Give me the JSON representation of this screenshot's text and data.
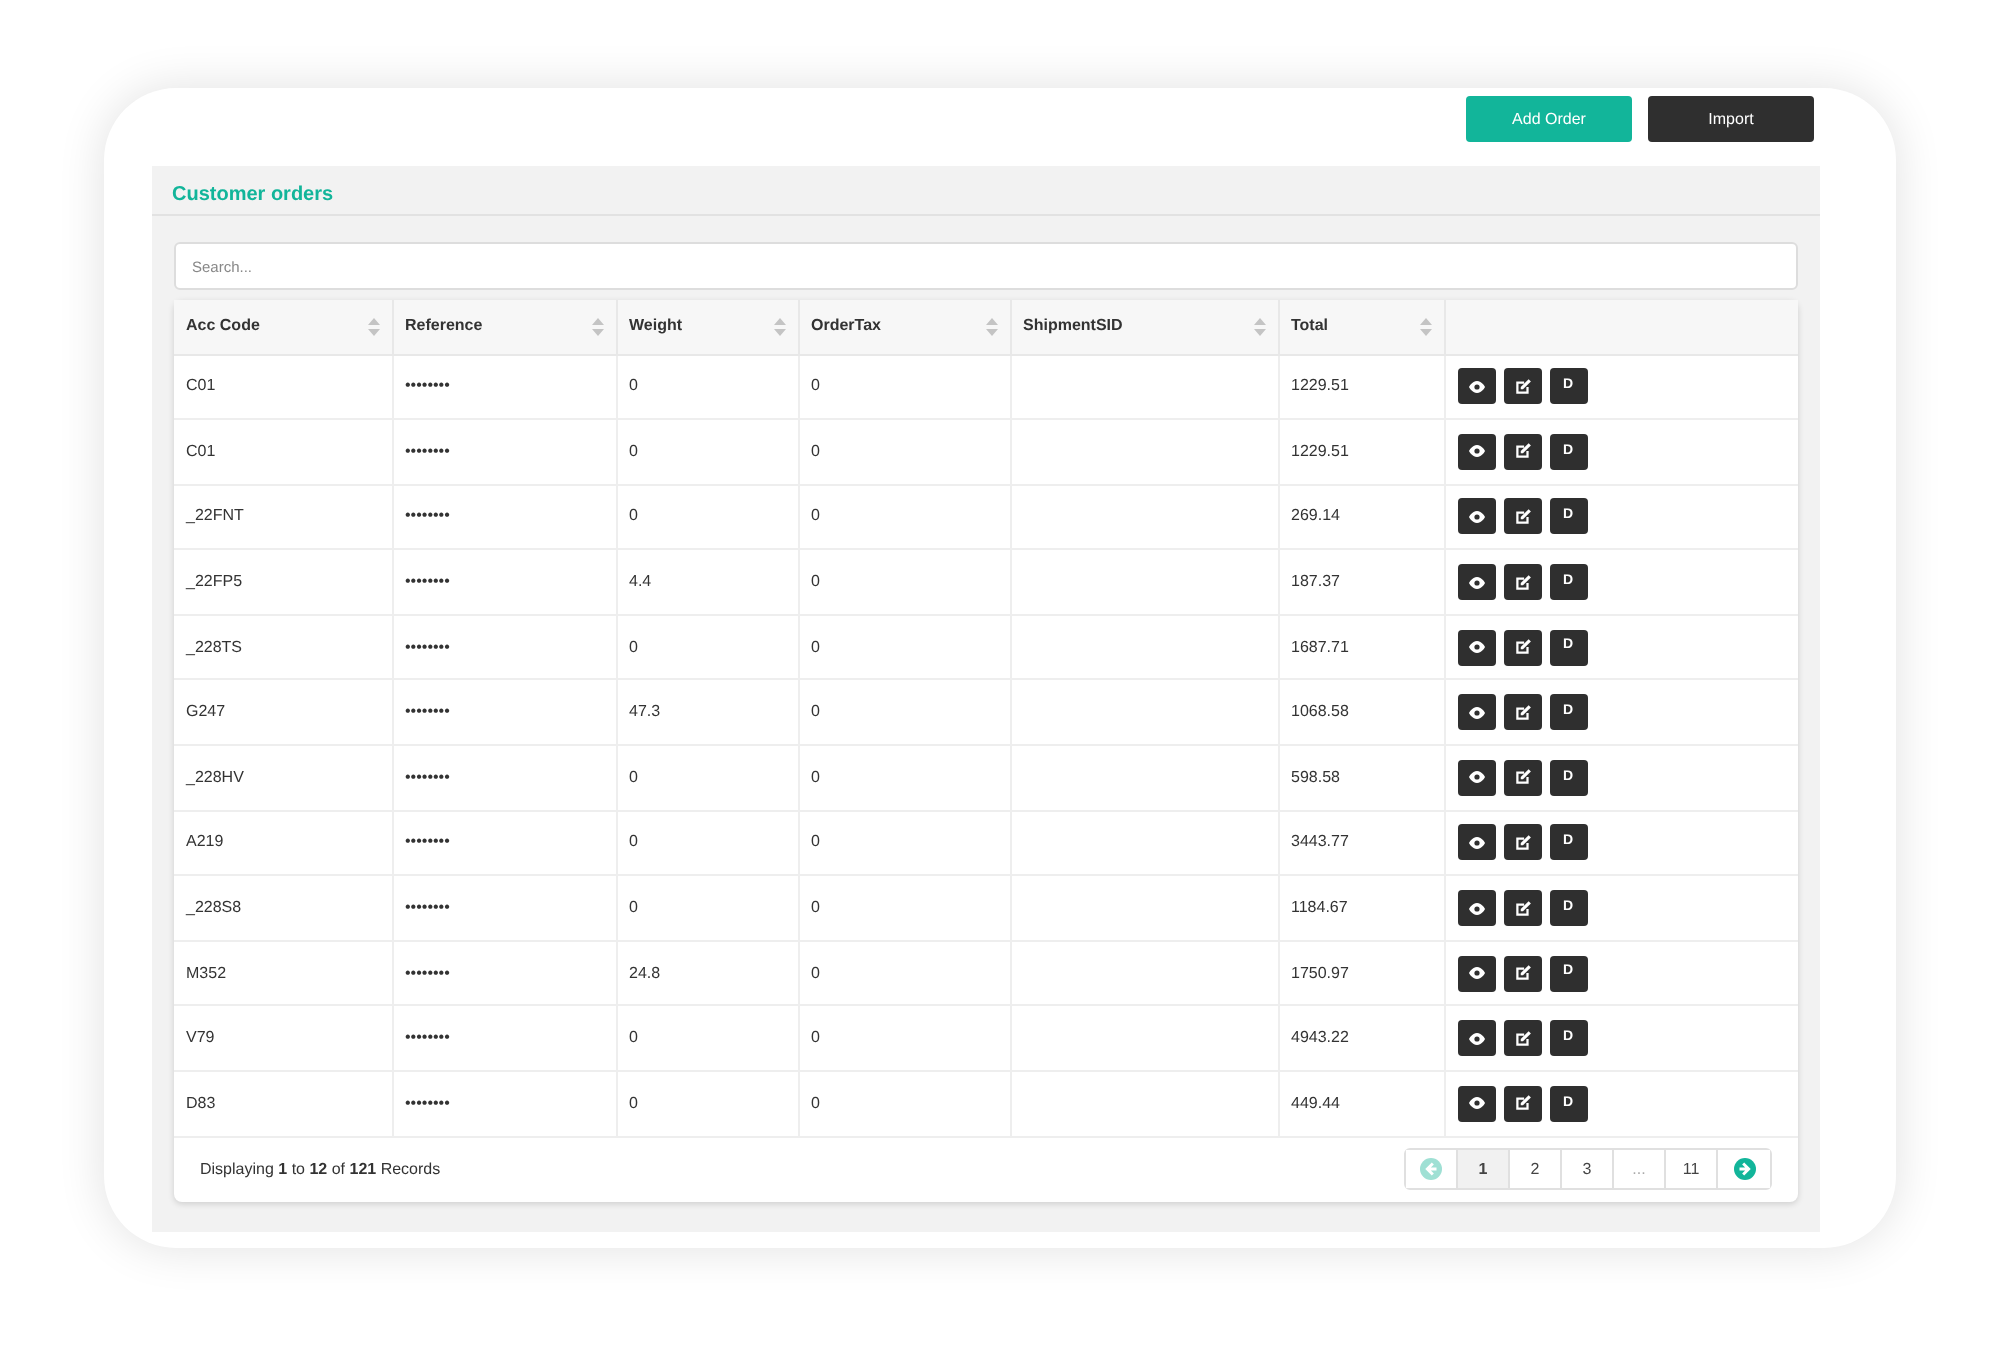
{
  "header_buttons": [
    {
      "label": "Add Order",
      "kind": "primary"
    },
    {
      "label": "Import",
      "kind": "dark"
    }
  ],
  "panel": {
    "title": "Customer orders"
  },
  "search": {
    "placeholder": "Search..."
  },
  "table": {
    "columns": [
      {
        "label": "Acc Code",
        "sortable": true
      },
      {
        "label": "Reference",
        "sortable": true
      },
      {
        "label": "Weight",
        "sortable": true
      },
      {
        "label": "OrderTax",
        "sortable": true
      },
      {
        "label": "ShipmentSID",
        "sortable": true
      },
      {
        "label": "Total",
        "sortable": true
      },
      {
        "sortable": false
      }
    ],
    "rows": [
      {
        "acc_code": "C01",
        "reference": "••••••••",
        "weight": "0",
        "order_tax": "0",
        "total": "1229.51",
        "delete_label": "D"
      },
      {
        "acc_code": "C01",
        "reference": "••••••••",
        "weight": "0",
        "order_tax": "0",
        "total": "1229.51",
        "delete_label": "D"
      },
      {
        "acc_code": "_22FNT",
        "reference": "••••••••",
        "weight": "0",
        "order_tax": "0",
        "total": "269.14",
        "delete_label": "D"
      },
      {
        "acc_code": "_22FP5",
        "reference": "••••••••",
        "weight": "4.4",
        "order_tax": "0",
        "total": "187.37",
        "delete_label": "D"
      },
      {
        "acc_code": "_228TS",
        "reference": "••••••••",
        "weight": "0",
        "order_tax": "0",
        "total": "1687.71",
        "delete_label": "D"
      },
      {
        "acc_code": "G247",
        "reference": "••••••••",
        "weight": "47.3",
        "order_tax": "0",
        "total": "1068.58",
        "delete_label": "D"
      },
      {
        "acc_code": "_228HV",
        "reference": "••••••••",
        "weight": "0",
        "order_tax": "0",
        "total": "598.58",
        "delete_label": "D"
      },
      {
        "acc_code": "A219",
        "reference": "••••••••",
        "weight": "0",
        "order_tax": "0",
        "total": "3443.77",
        "delete_label": "D"
      },
      {
        "acc_code": "_228S8",
        "reference": "••••••••",
        "weight": "0",
        "order_tax": "0",
        "total": "1184.67",
        "delete_label": "D"
      },
      {
        "acc_code": "M352",
        "reference": "••••••••",
        "weight": "24.8",
        "order_tax": "0",
        "total": "1750.97",
        "delete_label": "D"
      },
      {
        "acc_code": "V79",
        "reference": "••••••••",
        "weight": "0",
        "order_tax": "0",
        "total": "4943.22",
        "delete_label": "D"
      },
      {
        "acc_code": "D83",
        "reference": "••••••••",
        "weight": "0",
        "order_tax": "0",
        "total": "449.44",
        "delete_label": "D"
      }
    ]
  },
  "footer": {
    "summary": "Displaying **1** to **12** of **121** Records",
    "pagination": [
      {
        "kind": "prev",
        "disabled": true
      },
      {
        "kind": "page",
        "label": "1",
        "selected": true
      },
      {
        "kind": "page",
        "label": "2",
        "selected": false
      },
      {
        "kind": "page",
        "label": "3",
        "selected": false
      },
      {
        "kind": "gap",
        "label": "..."
      },
      {
        "kind": "page",
        "label": "11",
        "selected": false
      },
      {
        "kind": "next",
        "disabled": false
      }
    ]
  }
}
